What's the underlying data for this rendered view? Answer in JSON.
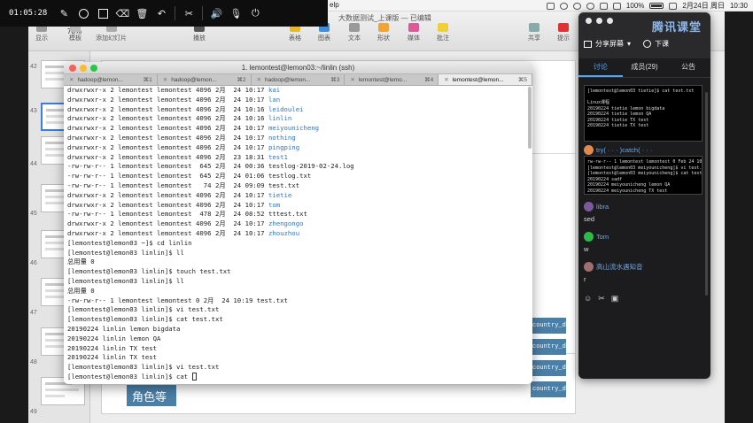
{
  "menubar": {
    "help": "elp",
    "battery": "100%",
    "date": "2月24日 周日",
    "time": "10:30"
  },
  "recorder": {
    "time": "01:05:28"
  },
  "keynote": {
    "doc_title": "大数据测试_上课版 — 已编辑",
    "zoom": "78%",
    "toolbar": [
      "显示",
      "模板",
      "添加幻灯片",
      "播放",
      "表格",
      "图表",
      "文本",
      "形状",
      "媒体",
      "批注",
      "共享",
      "提示"
    ],
    "thumb_numbers": [
      "42",
      "43",
      "44",
      "45",
      "46",
      "47",
      "48",
      "49"
    ],
    "canvas_badges": [
      "country_da",
      "country_da",
      "country_da",
      "country_da"
    ],
    "role_label": "角色等"
  },
  "terminal": {
    "title": "1. lemontest@lemon03:~/linlin (ssh)",
    "tabs": [
      {
        "label": "hadoop@lemon...",
        "key": "⌘1"
      },
      {
        "label": "hadoop@lemon...",
        "key": "⌘2"
      },
      {
        "label": "hadoop@lemon...",
        "key": "⌘3"
      },
      {
        "label": "lemontest@lemo...",
        "key": "⌘4"
      },
      {
        "label": "lemontest@lemon...",
        "key": "⌘5"
      }
    ],
    "lines": [
      {
        "t": "drwxrwxr-x 2 lemontest lemontest 4096 2月  24 10:17 ",
        "d": "kai"
      },
      {
        "t": "drwxrwxr-x 2 lemontest lemontest 4096 2月  24 10:17 ",
        "d": "lan"
      },
      {
        "t": "drwxrwxr-x 2 lemontest lemontest 4096 2月  24 10:16 ",
        "d": "leidoulei"
      },
      {
        "t": "drwxrwxr-x 2 lemontest lemontest 4096 2月  24 10:16 ",
        "d": "linlin"
      },
      {
        "t": "drwxrwxr-x 2 lemontest lemontest 4096 2月  24 10:17 ",
        "d": "meiyounicheng"
      },
      {
        "t": "drwxrwxr-x 2 lemontest lemontest 4096 2月  24 10:17 ",
        "d": "nothing"
      },
      {
        "t": "drwxrwxr-x 2 lemontest lemontest 4096 2月  24 10:17 ",
        "d": "pingping"
      },
      {
        "t": "drwxrwxr-x 2 lemontest lemontest 4096 2月  23 18:31 ",
        "d": "test1"
      },
      {
        "t": "-rw-rw-r-- 1 lemontest lemontest  645 2月  24 00:36 testlog-2019-02-24.log",
        "d": ""
      },
      {
        "t": "-rw-rw-r-- 1 lemontest lemontest  645 2月  24 01:06 testlog.txt",
        "d": ""
      },
      {
        "t": "-rw-rw-r-- 1 lemontest lemontest   74 2月  24 09:09 test.txt",
        "d": ""
      },
      {
        "t": "drwxrwxr-x 2 lemontest lemontest 4096 2月  24 10:17 ",
        "d": "tietie"
      },
      {
        "t": "drwxrwxr-x 2 lemontest lemontest 4096 2月  24 10:17 ",
        "d": "tom"
      },
      {
        "t": "-rw-rw-r-- 1 lemontest lemontest  478 2月  24 08:52 tttest.txt",
        "d": ""
      },
      {
        "t": "drwxrwxr-x 2 lemontest lemontest 4096 2月  24 10:17 ",
        "d": "zhengongo"
      },
      {
        "t": "drwxrwxr-x 2 lemontest lemontest 4096 2月  24 10:17 ",
        "d": "zhouzhou"
      },
      {
        "t": "[lemontest@lemon03 ~]$ cd linlin",
        "d": ""
      },
      {
        "t": "[lemontest@lemon03 linlin]$ ll",
        "d": ""
      },
      {
        "t": "总用量 0",
        "d": ""
      },
      {
        "t": "[lemontest@lemon03 linlin]$ touch test.txt",
        "d": ""
      },
      {
        "t": "[lemontest@lemon03 linlin]$ ll",
        "d": ""
      },
      {
        "t": "总用量 0",
        "d": ""
      },
      {
        "t": "-rw-rw-r-- 1 lemontest lemontest 0 2月  24 10:19 test.txt",
        "d": ""
      },
      {
        "t": "[lemontest@lemon03 linlin]$ vi test.txt",
        "d": ""
      },
      {
        "t": "[lemontest@lemon03 linlin]$ cat test.txt",
        "d": ""
      },
      {
        "t": "20190224 linlin lemon bigdata",
        "d": ""
      },
      {
        "t": "20190224 linlin lemon QA",
        "d": ""
      },
      {
        "t": "20190224 linlin TX test",
        "d": ""
      },
      {
        "t": "20190224 linlin TX test",
        "d": ""
      },
      {
        "t": "[lemontest@lemon03 linlin]$ vi test.txt",
        "d": ""
      },
      {
        "t": "[lemontest@lemon03 linlin]$ cat ",
        "d": ""
      }
    ]
  },
  "panel": {
    "brand": "腾讯课堂",
    "share": "分享屏幕",
    "end": "下课",
    "tabs": [
      "讨论",
      "成员(29)",
      "公告"
    ],
    "shot1": "[lemontest@lemon03 tietie]$ cat test.txt\n\nLinux课程\n20190224 tietie lemon bigdata\n20190224 tietie lemon QA\n20190224 tietie TX test\n20190224 tietie TX test",
    "user2": "try( · · · )catch( · · ·",
    "shot2": "rw-rw-r-- 1 lemontest lemontest 0 Feb 24 10:18 test\n[lemontest@lemon03 meiyounicheng]$ vi test.txt\n[lemontest@lemon03 meiyounicheng]$ cat test.txt\n20190224 sadf\n20190224 meiyounicheng lemon QA\n20190224 meiyounicheng TX test\n[lemontest@lemon03 meiyounicheng]$",
    "messages": [
      {
        "name": "libra",
        "text": "sed"
      },
      {
        "name": "Tom",
        "text": "w"
      },
      {
        "name": "高山流水遇知音",
        "text": "r"
      }
    ]
  }
}
